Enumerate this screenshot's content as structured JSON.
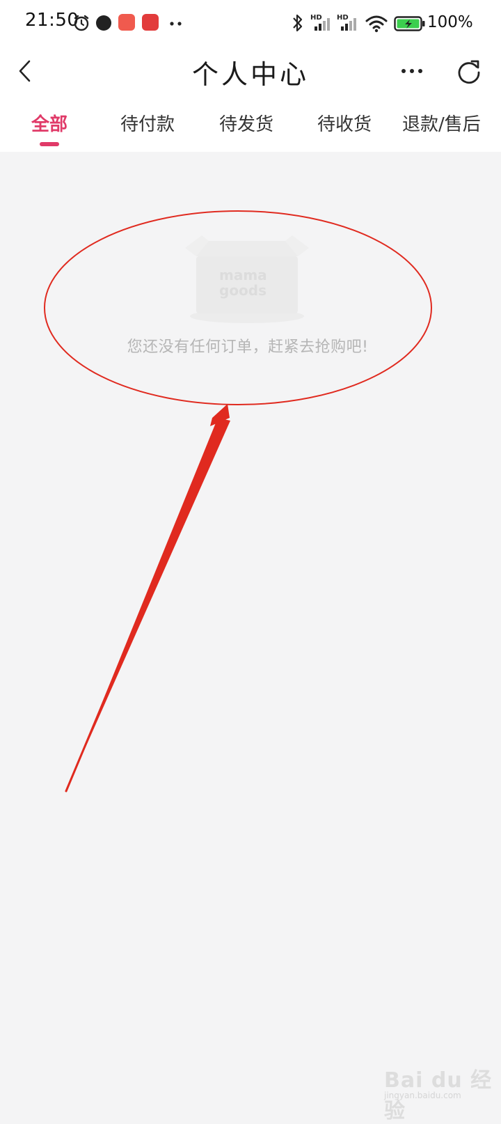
{
  "status_bar": {
    "time": "21:50",
    "battery_percent": "100%",
    "icons": [
      "alarm-icon",
      "app-icon",
      "app-icon",
      "app-icon",
      "more-dots-icon",
      "bluetooth-icon",
      "hd-signal-icon",
      "hd-signal-icon",
      "wifi-icon",
      "battery-charging-icon"
    ]
  },
  "app_bar": {
    "title": "个人中心",
    "back_icon": "chevron-left-icon",
    "more_icon": "more-horizontal-icon",
    "refresh_icon": "refresh-icon"
  },
  "tabs": [
    {
      "label": "全部",
      "active": true
    },
    {
      "label": "待付款",
      "active": false
    },
    {
      "label": "待发货",
      "active": false
    },
    {
      "label": "待收货",
      "active": false
    },
    {
      "label": "退款/售后",
      "active": false
    }
  ],
  "empty_state": {
    "illustration_text_line1": "mama",
    "illustration_text_line2": "goods",
    "message": "您还没有任何订单，赶紧去抢购吧!"
  },
  "watermark": {
    "brand": "Bai du 经验",
    "url": "jingyan.baidu.com"
  },
  "colors": {
    "accent": "#e03a68",
    "annotation": "#e02a1f",
    "background": "#f4f4f5"
  }
}
